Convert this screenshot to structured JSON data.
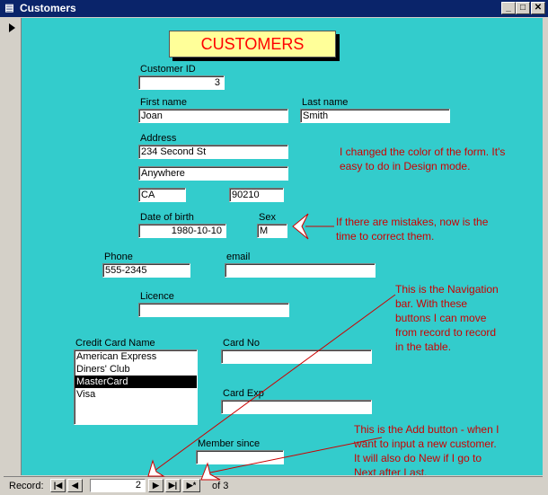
{
  "window": {
    "title": "Customers",
    "controls": {
      "minimize": "_",
      "maximize": "□",
      "close": "✕"
    }
  },
  "form": {
    "header": "CUSTOMERS",
    "fields": {
      "customer_id": {
        "label": "Customer ID",
        "value": "3"
      },
      "first_name": {
        "label": "First name",
        "value": "Joan"
      },
      "last_name": {
        "label": "Last name",
        "value": "Smith"
      },
      "address_label": "Address",
      "address1": "234 Second St",
      "city": "Anywhere",
      "state": "CA",
      "zip": "90210",
      "dob": {
        "label": "Date of birth",
        "value": "1980-10-10"
      },
      "sex": {
        "label": "Sex",
        "value": "M"
      },
      "phone": {
        "label": "Phone",
        "value": "555-2345"
      },
      "email": {
        "label": "email",
        "value": ""
      },
      "licence": {
        "label": "Licence",
        "value": ""
      },
      "credit_card_name": {
        "label": "Credit Card Name",
        "options": [
          "American Express",
          "Diners' Club",
          "MasterCard",
          "Visa"
        ],
        "selected": "MasterCard"
      },
      "card_no": {
        "label": "Card No",
        "value": ""
      },
      "card_exp": {
        "label": "Card Exp",
        "value": ""
      },
      "member_since": {
        "label": "Member since",
        "value": ""
      }
    }
  },
  "annotations": {
    "color_note_1": "I changed the color of the form. It's",
    "color_note_2": "easy to do in Design mode.",
    "mistakes_note_1": "If there are mistakes, now is the",
    "mistakes_note_2": "time to correct them.",
    "nav_note_1": "This is the Navigation",
    "nav_note_2": "bar. With these",
    "nav_note_3": "buttons I can move",
    "nav_note_4": "from record to record",
    "nav_note_5": "in the table.",
    "add_note_1": "This is the Add button - when I",
    "add_note_2": "want to input a new customer.",
    "add_note_3": "It will also do New if I go to",
    "add_note_4": "Next after Last."
  },
  "navbar": {
    "label": "Record:",
    "current": "2",
    "of_label": "of",
    "total": "3",
    "buttons": {
      "first": "|◀",
      "prev": "◀",
      "next": "▶",
      "last": "▶|",
      "new": "▶*"
    }
  },
  "colors": {
    "form_background": "#33cccc",
    "header_background": "#ffff99",
    "header_text": "#ff0000",
    "annotation_text": "#cc0000",
    "titlebar": "#0a246a"
  }
}
